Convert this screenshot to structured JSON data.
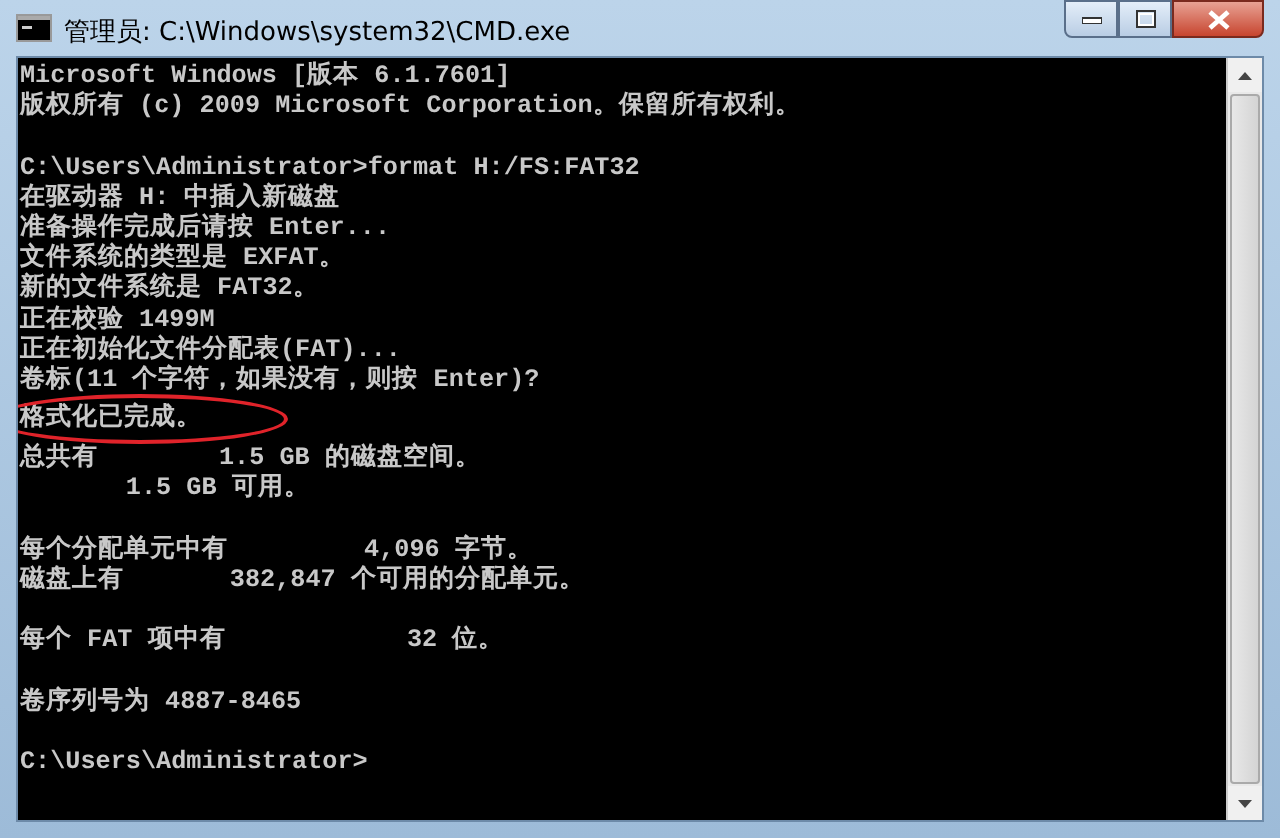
{
  "window": {
    "title": "管理员: C:\\Windows\\system32\\CMD.exe"
  },
  "console": {
    "blocks": [
      {
        "lines": [
          {
            "text": "Microsoft Windows [版本 6.1.7601]",
            "circled": false
          },
          {
            "text": "版权所有 (c) 2009 Microsoft Corporation。保留所有权利。",
            "circled": false
          }
        ]
      },
      {
        "lines": [
          {
            "text": "C:\\Users\\Administrator>format H:/FS:FAT32",
            "circled": false
          },
          {
            "text": "在驱动器 H: 中插入新磁盘",
            "circled": false
          },
          {
            "text": "准备操作完成后请按 Enter...",
            "circled": false
          },
          {
            "text": "文件系统的类型是 EXFAT。",
            "circled": false
          },
          {
            "text": "新的文件系统是 FAT32。",
            "circled": false
          },
          {
            "text": "正在校验 1499M",
            "circled": false
          },
          {
            "text": "正在初始化文件分配表(FAT)...",
            "circled": false
          },
          {
            "text": "卷标(11 个字符，如果没有，则按 Enter)?",
            "circled": false
          },
          {
            "text": "格式化已完成。",
            "circled": true
          },
          {
            "text": "总共有        1.5 GB 的磁盘空间。",
            "circled": false
          },
          {
            "text": "       1.5 GB 可用。",
            "circled": false
          }
        ]
      },
      {
        "lines": [
          {
            "text": "每个分配单元中有         4,096 字节。",
            "circled": false
          },
          {
            "text": "磁盘上有       382,847 个可用的分配单元。",
            "circled": false
          }
        ]
      },
      {
        "lines": [
          {
            "text": "每个 FAT 项中有            32 位。",
            "circled": false
          }
        ]
      },
      {
        "lines": [
          {
            "text": "卷序列号为 4887-8465",
            "circled": false
          }
        ]
      },
      {
        "lines": [
          {
            "text": "C:\\Users\\Administrator>",
            "circled": false
          }
        ]
      }
    ]
  }
}
